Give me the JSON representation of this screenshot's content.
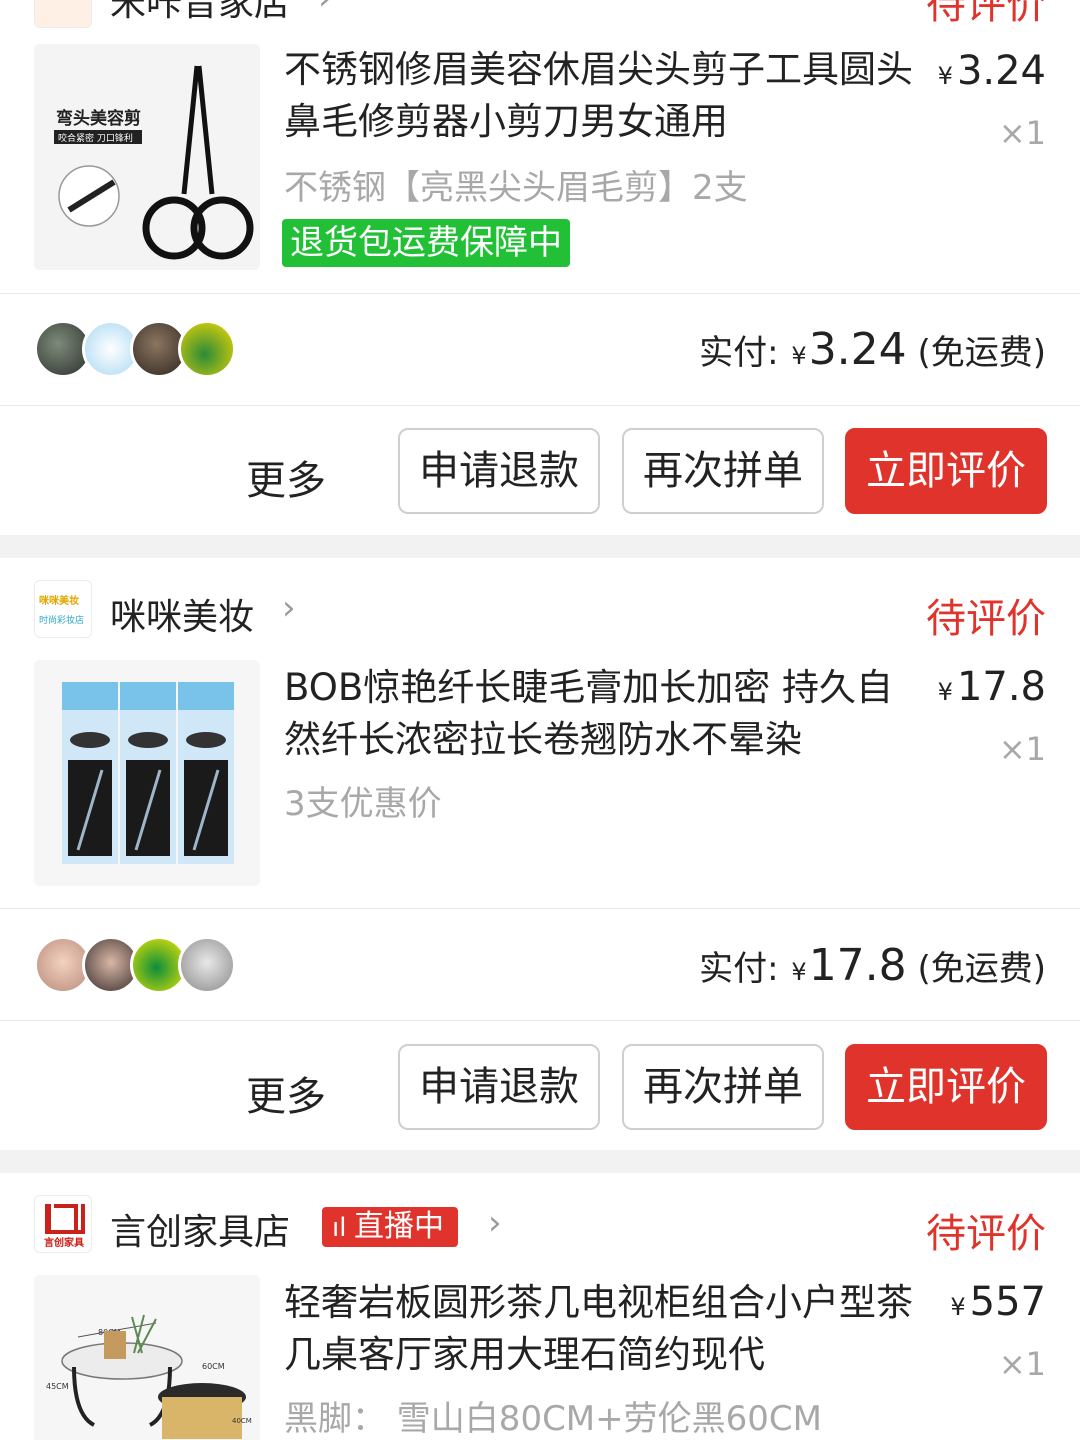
{
  "orders": [
    {
      "shop_name": "米咔音家店",
      "status": "待评价",
      "product": {
        "title": "不锈钢修眉美容休眉尖头剪子工具圆头鼻毛修剪器小剪刀男女通用",
        "spec": "不锈钢【亮黑尖头眉毛剪】2支",
        "price_symbol": "¥",
        "price": "3.24",
        "qty": "×1",
        "tag": "退货包运费保障中",
        "thumb_text_1": "弯头美容剪",
        "thumb_text_2": "咬合紧密 刀口锋利"
      },
      "paid_label": "实付:",
      "paid_symbol": "¥",
      "paid_amount": "3.24",
      "paid_note": "(免运费)",
      "actions": {
        "more": "更多",
        "refund": "申请退款",
        "regroup": "再次拼单",
        "review": "立即评价"
      }
    },
    {
      "shop_name": "咪咪美妆",
      "shop_logo_text_1": "咪咪美妆",
      "shop_logo_text_2": "时尚彩妆店",
      "status": "待评价",
      "product": {
        "title": "BOB惊艳纤长睫毛膏加长加密 持久自然纤长浓密拉长卷翘防水不晕染",
        "spec": "3支优惠价",
        "price_symbol": "¥",
        "price": "17.8",
        "qty": "×1"
      },
      "paid_label": "实付:",
      "paid_symbol": "¥",
      "paid_amount": "17.8",
      "paid_note": "(免运费)",
      "actions": {
        "more": "更多",
        "refund": "申请退款",
        "regroup": "再次拼单",
        "review": "立即评价"
      }
    },
    {
      "shop_name": "言创家具店",
      "shop_logo_text": "言创家具",
      "live_badge": "直播中",
      "status": "待评价",
      "product": {
        "title": "轻奢岩板圆形茶几电视柜组合小户型茶几桌客厅家用大理石简约现代",
        "spec": "黑脚： 雪山白80CM+劳伦黑60CM",
        "price_symbol": "¥",
        "price": "557",
        "qty": "×1",
        "dim_1": "80CM",
        "dim_2": "60CM",
        "dim_3": "45CM",
        "dim_4": "40CM"
      }
    }
  ],
  "colors": {
    "accent": "#e0332b",
    "green_tag": "#22c036",
    "muted": "#a8a8a8"
  }
}
